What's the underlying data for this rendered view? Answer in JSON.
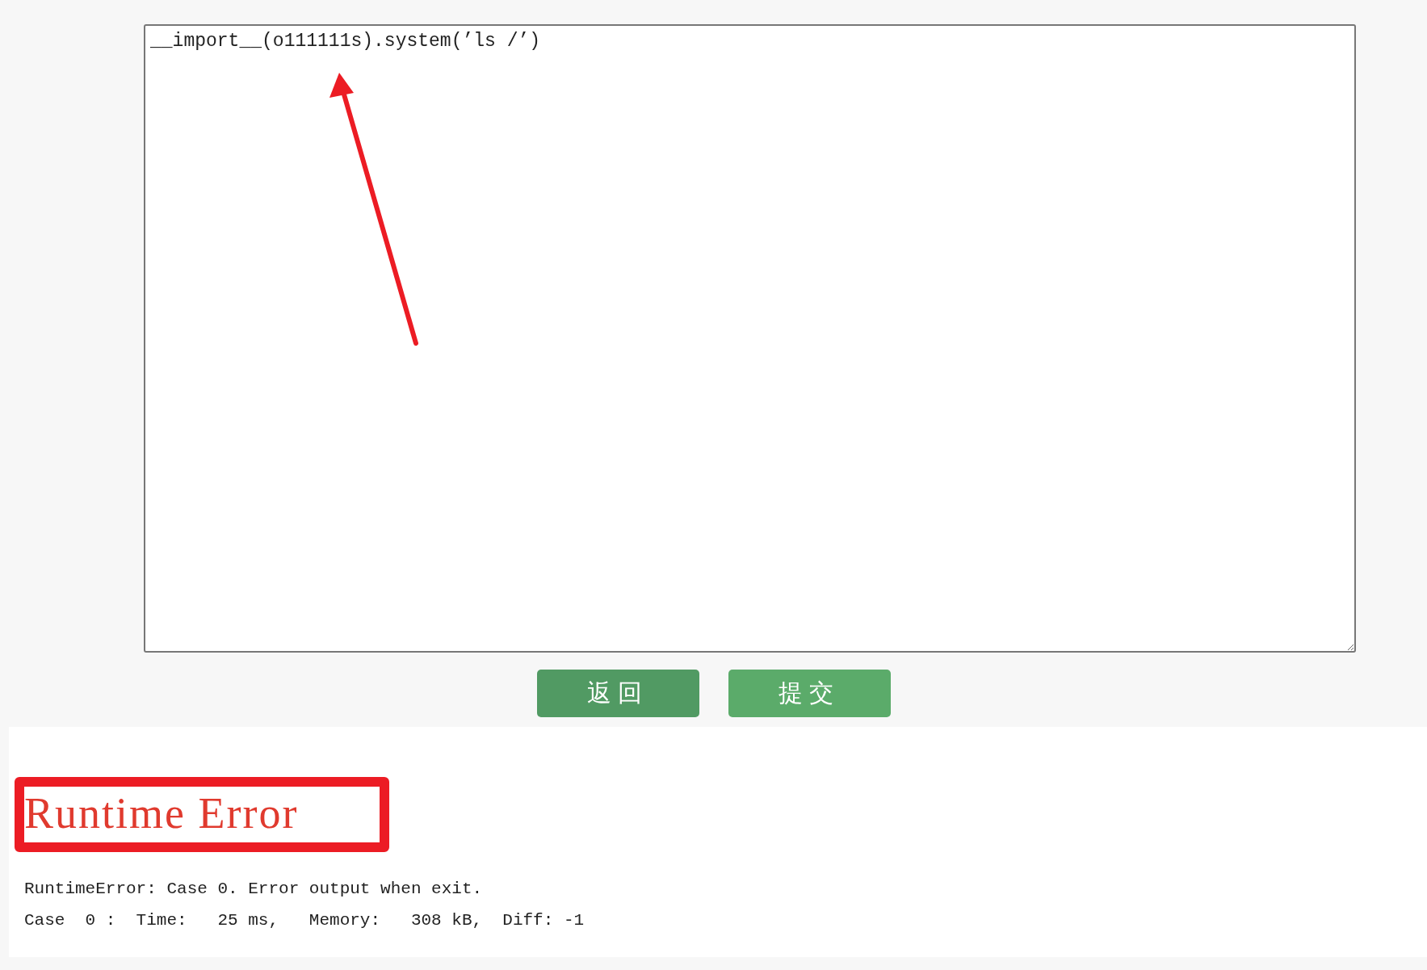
{
  "editor": {
    "value": "__import__(o111111s).system(’ls /’)"
  },
  "buttons": [
    {
      "label": "返回",
      "kind": "back"
    },
    {
      "label": "提交",
      "kind": "submit"
    }
  ],
  "result": {
    "status": "Runtime Error",
    "highlighted": true,
    "lines": [
      "RuntimeError: Case 0. Error output when exit.",
      "Case  0 :  Time:   25 ms,   Memory:   308 kB,  Diff: -1"
    ]
  },
  "annotation": {
    "arrow": true
  }
}
